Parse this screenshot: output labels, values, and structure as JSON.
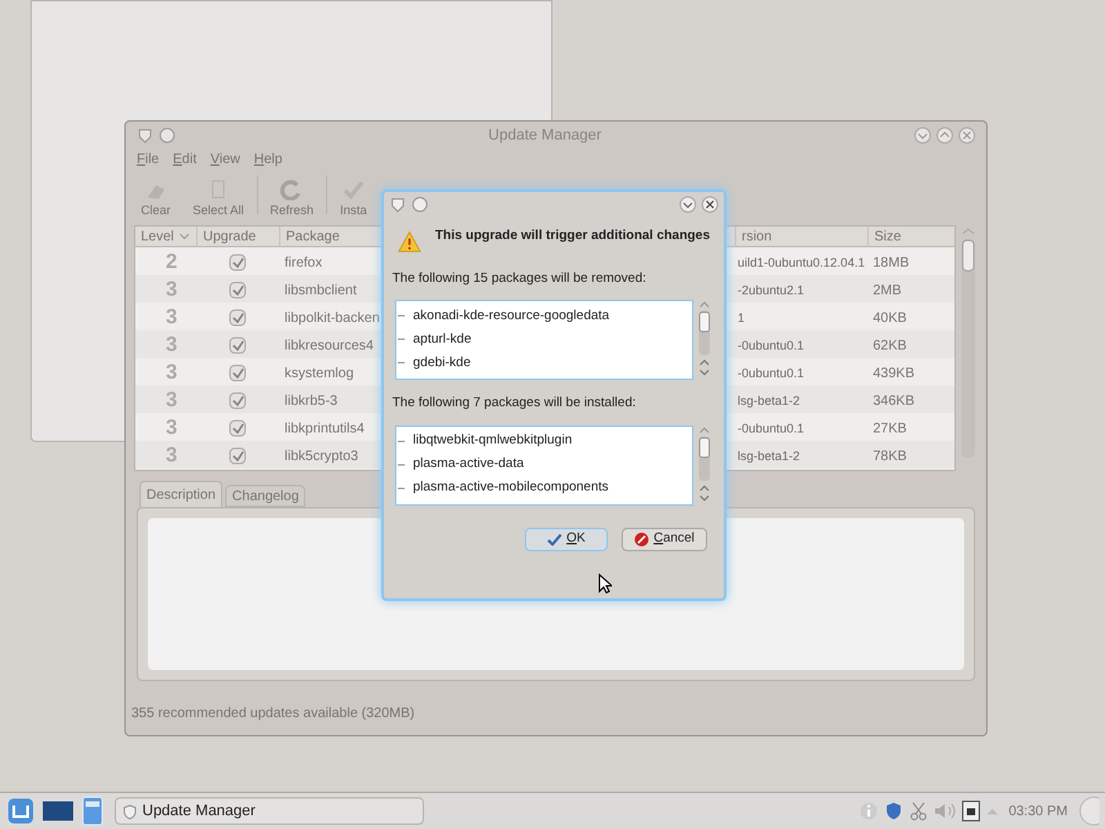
{
  "window": {
    "title": "Update Manager"
  },
  "menu": [
    "File",
    "Edit",
    "View",
    "Help"
  ],
  "toolbar": [
    {
      "label": "Clear",
      "kind": "clear"
    },
    {
      "label": "Select All",
      "kind": "select"
    },
    {
      "label": "Refresh",
      "kind": "refresh"
    },
    {
      "label": "Insta",
      "kind": "install"
    }
  ],
  "table": {
    "columns": [
      "Level",
      "Upgrade",
      "Package",
      "rsion",
      "Size"
    ],
    "rows": [
      {
        "level": "2",
        "checked": true,
        "package": "firefox",
        "version": "uild1-0ubuntu0.12.04.1",
        "size": "18MB"
      },
      {
        "level": "3",
        "checked": true,
        "package": "libsmbclient",
        "version": "-2ubuntu2.1",
        "size": "2MB"
      },
      {
        "level": "3",
        "checked": true,
        "package": "libpolkit-backen",
        "version": "1",
        "size": "40KB"
      },
      {
        "level": "3",
        "checked": true,
        "package": "libkresources4",
        "version": "-0ubuntu0.1",
        "size": "62KB"
      },
      {
        "level": "3",
        "checked": true,
        "package": "ksystemlog",
        "version": "-0ubuntu0.1",
        "size": "439KB"
      },
      {
        "level": "3",
        "checked": true,
        "package": "libkrb5-3",
        "version": "lsg-beta1-2",
        "size": "346KB"
      },
      {
        "level": "3",
        "checked": true,
        "package": "libkprintutils4",
        "version": "-0ubuntu0.1",
        "size": "27KB"
      },
      {
        "level": "3",
        "checked": true,
        "package": "libk5crypto3",
        "version": "lsg-beta1-2",
        "size": "78KB"
      }
    ]
  },
  "tabs": [
    {
      "label": "Description",
      "selected": true
    },
    {
      "label": "Changelog",
      "selected": false
    }
  ],
  "status_bar": "355 recommended updates available (320MB)",
  "dialog": {
    "heading": "This upgrade will trigger additional changes",
    "removed_label": "The following 15 packages will be removed:",
    "removed": [
      "akonadi-kde-resource-googledata",
      "apturl-kde",
      "gdebi-kde"
    ],
    "installed_label": "The following 7 packages will be installed:",
    "installed": [
      "libqtwebkit-qmlwebkitplugin",
      "plasma-active-data",
      "plasma-active-mobilecomponents"
    ],
    "buttons": [
      {
        "label": "OK",
        "kind": "ok"
      },
      {
        "label": "Cancel",
        "kind": "cancel"
      }
    ]
  },
  "taskbar": {
    "task": "Update Manager",
    "clock": "03:30 PM"
  }
}
